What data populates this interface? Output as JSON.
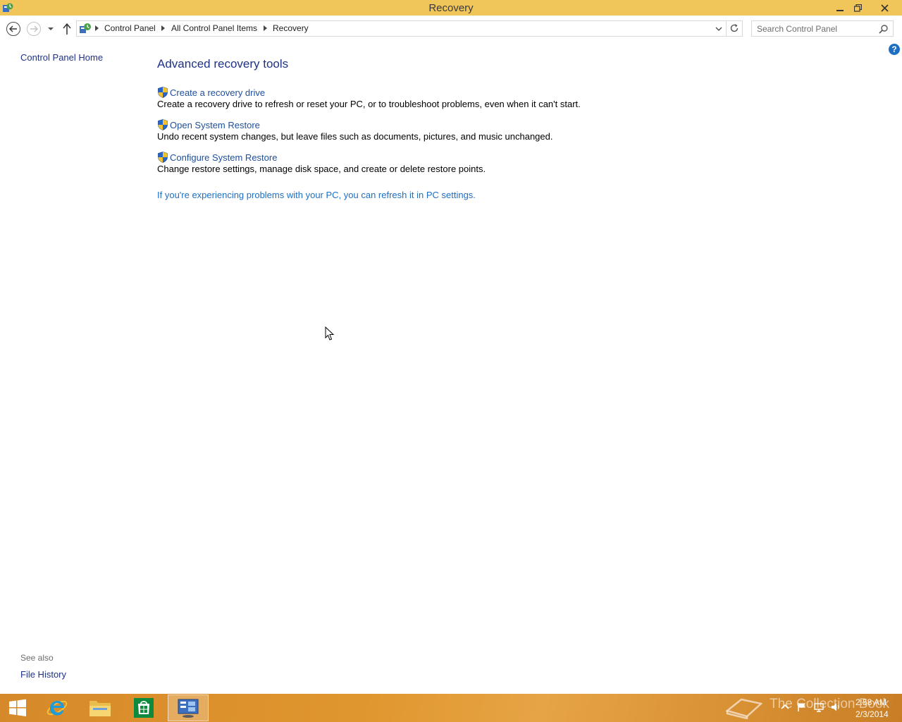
{
  "window": {
    "title": "Recovery",
    "accent": "#f0c55a"
  },
  "address": {
    "crumbs": [
      "Control Panel",
      "All Control Panel Items",
      "Recovery"
    ],
    "search_placeholder": "Search Control Panel"
  },
  "sidebar": {
    "home_label": "Control Panel Home",
    "see_also_label": "See also",
    "see_also_items": [
      "File History"
    ]
  },
  "main": {
    "heading": "Advanced recovery tools",
    "tools": [
      {
        "link": "Create a recovery drive",
        "description": "Create a recovery drive to refresh or reset your PC, or to troubleshoot problems, even when it can't start.",
        "icon": "uac-shield-icon"
      },
      {
        "link": "Open System Restore",
        "description": "Undo recent system changes, but leave files such as documents, pictures, and music unchanged.",
        "icon": "uac-shield-icon"
      },
      {
        "link": "Configure System Restore",
        "description": "Change restore settings, manage disk space, and create or delete restore points.",
        "icon": "uac-shield-icon"
      }
    ],
    "refresh_link": "If you're experiencing problems with your PC, you can refresh it in PC settings."
  },
  "taskbar": {
    "watermark": "The Collection Book",
    "clock_time": "2:58 AM",
    "clock_date": "2/3/2014",
    "apps": [
      "start-button",
      "internet-explorer",
      "file-explorer",
      "store",
      "control-panel"
    ]
  },
  "colors": {
    "link": "#1e4f9c",
    "heading": "#1e3287",
    "taskbar": "#d6892a"
  }
}
